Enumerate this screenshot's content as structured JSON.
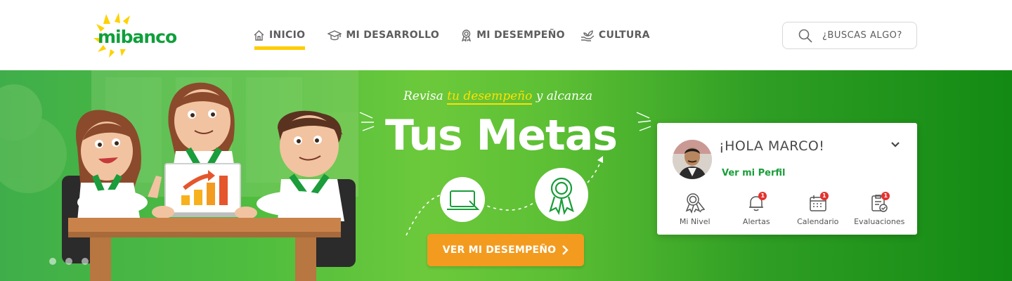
{
  "header": {
    "logo_text": "mibanco",
    "nav": [
      {
        "label": "INICIO",
        "icon": "home-icon",
        "active": true
      },
      {
        "label": "MI DESARROLLO",
        "icon": "graduation-cap-icon",
        "active": false
      },
      {
        "label": "MI DESEMPEÑO",
        "icon": "award-ribbon-icon",
        "active": false
      },
      {
        "label": "CULTURA",
        "icon": "hand-plant-icon",
        "active": false
      }
    ],
    "search": {
      "placeholder": "¿BUSCAS ALGO?",
      "icon": "search-icon"
    }
  },
  "hero": {
    "tagline_before": "Revisa ",
    "tagline_highlight": "tu desempeño",
    "tagline_after": " y alcanza",
    "title": "Tus Metas",
    "cta_label": "VER MI DESEMPEÑO",
    "slider_dots": 3,
    "colors": {
      "accent_yellow": "#ffcc00",
      "cta_orange": "#f39b1f",
      "brand_green": "#0f9f3b"
    }
  },
  "profile_card": {
    "greeting": "¡HOLA MARCO!",
    "profile_link": "Ver mi Perfil",
    "quick_links": [
      {
        "label": "Mi Nivel",
        "icon": "medal-icon",
        "badge": ""
      },
      {
        "label": "Alertas",
        "icon": "bell-icon",
        "badge": "1"
      },
      {
        "label": "Calendario",
        "icon": "calendar-icon",
        "badge": "1"
      },
      {
        "label": "Evaluaciones",
        "icon": "clipboard-check-icon",
        "badge": "1"
      }
    ]
  }
}
